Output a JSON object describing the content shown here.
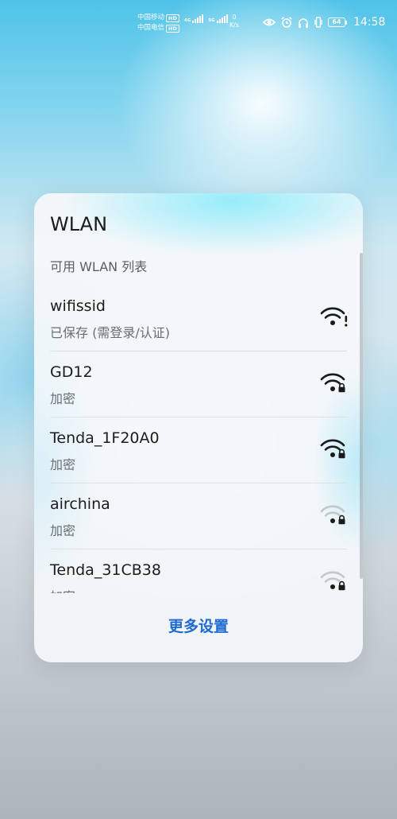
{
  "status_bar": {
    "carrier_1": "中国移动",
    "carrier_2": "中国电信",
    "hd_badge": "HD",
    "net_type_1": "4G",
    "net_type_2": "5G",
    "speed_value": "0",
    "speed_unit": "K/s",
    "battery_level": "64",
    "time": "14:58",
    "icon_color": "#ffffff"
  },
  "wlan_panel": {
    "title": "WLAN",
    "subtitle": "可用 WLAN 列表",
    "networks": [
      {
        "ssid": "wifissid",
        "status": "已保存 (需登录/认证)",
        "icon": "wifi-alert-icon",
        "signal_strength": "strong"
      },
      {
        "ssid": "GD12",
        "status": "加密",
        "icon": "wifi-lock-icon",
        "signal_strength": "strong"
      },
      {
        "ssid": "Tenda_1F20A0",
        "status": "加密",
        "icon": "wifi-lock-icon",
        "signal_strength": "strong"
      },
      {
        "ssid": "airchina",
        "status": "加密",
        "icon": "wifi-lock-icon",
        "signal_strength": "weak"
      },
      {
        "ssid": "Tenda_31CB38",
        "status": "加密",
        "icon": "wifi-lock-icon",
        "signal_strength": "weak"
      }
    ],
    "more_settings_label": "更多设置",
    "accent_color": "#1f6ad3"
  }
}
